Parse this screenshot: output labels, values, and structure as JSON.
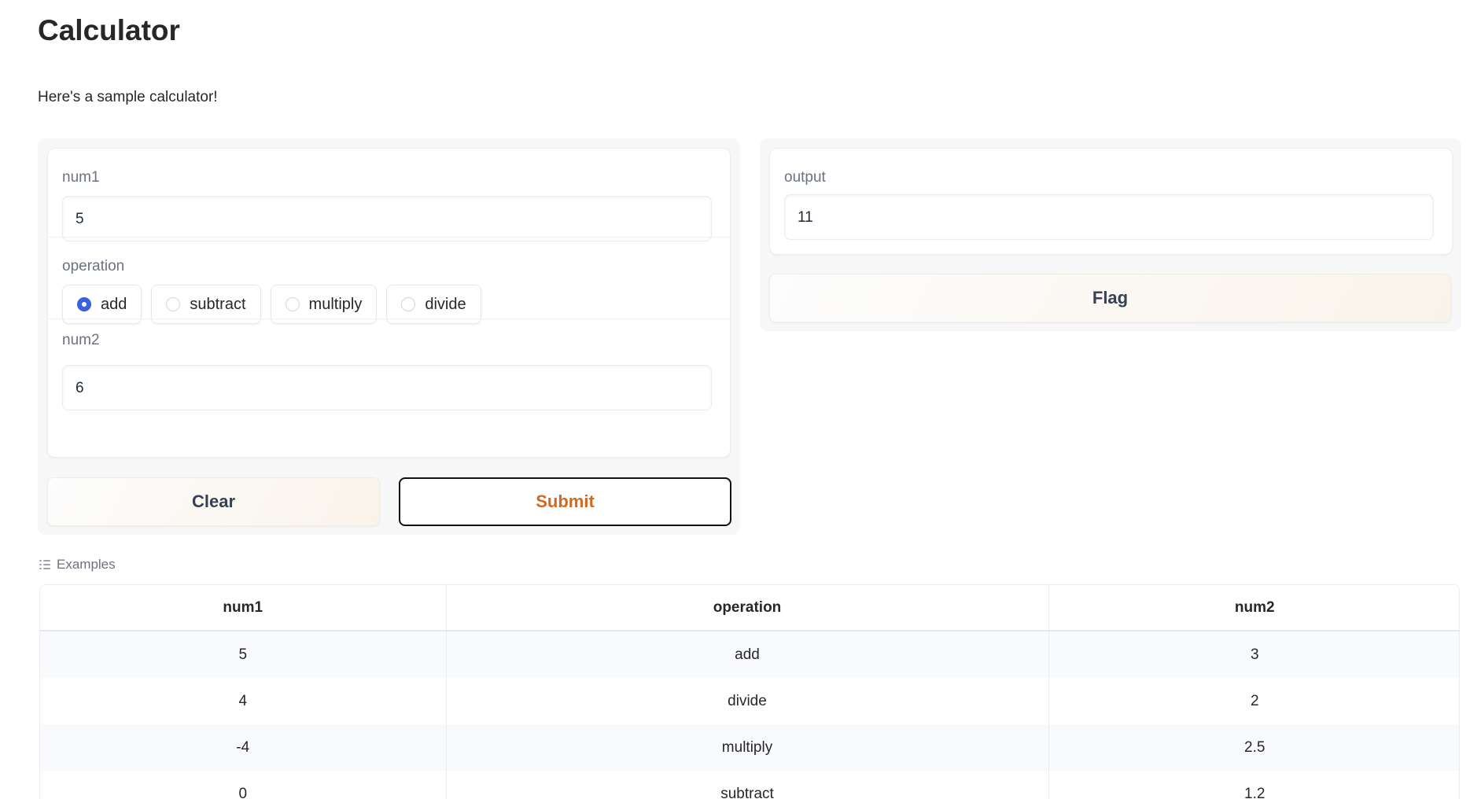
{
  "header": {
    "title": "Calculator",
    "description": "Here's a sample calculator!"
  },
  "inputs": {
    "num1": {
      "label": "num1",
      "value": "5"
    },
    "operation": {
      "label": "operation",
      "options": [
        "add",
        "subtract",
        "multiply",
        "divide"
      ],
      "selected": "add"
    },
    "num2": {
      "label": "num2",
      "value": "6"
    }
  },
  "actions": {
    "clear_label": "Clear",
    "submit_label": "Submit",
    "flag_label": "Flag"
  },
  "output": {
    "label": "output",
    "value": "11"
  },
  "examples": {
    "title": "Examples",
    "columns": [
      "num1",
      "operation",
      "num2"
    ],
    "rows": [
      [
        "5",
        "add",
        "3"
      ],
      [
        "4",
        "divide",
        "2"
      ],
      [
        "-4",
        "multiply",
        "2.5"
      ],
      [
        "0",
        "subtract",
        "1.2"
      ]
    ]
  },
  "colors": {
    "accent": "#3b5fe0",
    "submit_text": "#d2691e"
  },
  "icons": {
    "examples": "list-icon"
  }
}
